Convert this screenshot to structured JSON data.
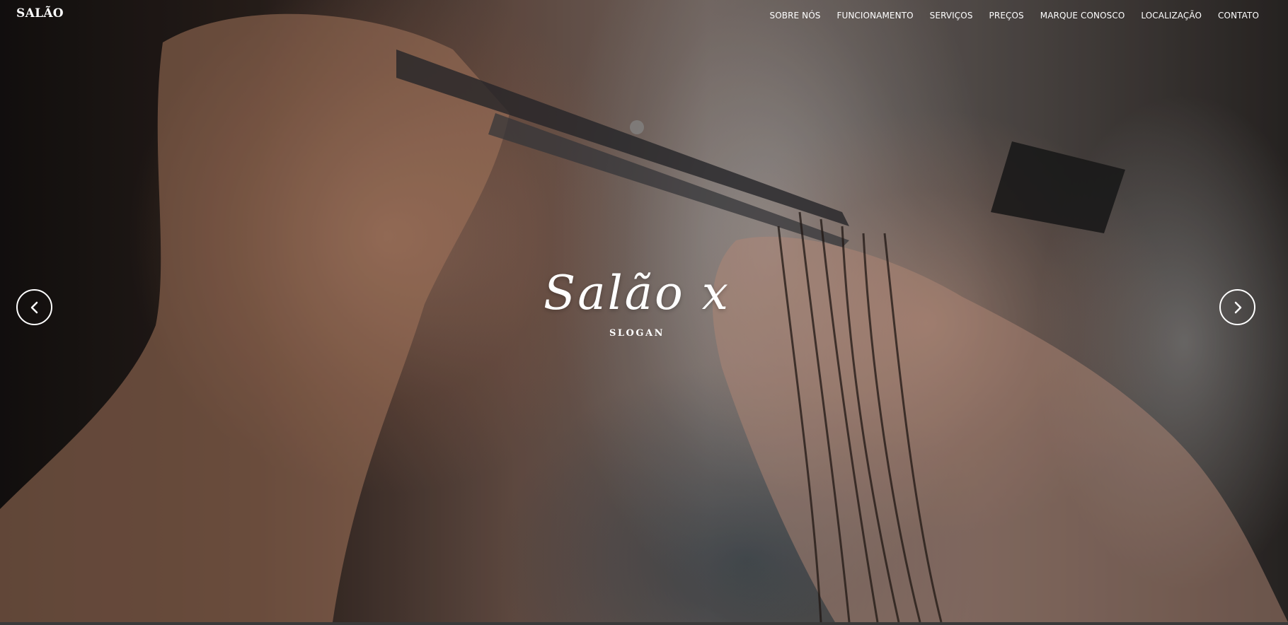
{
  "brand": {
    "name": "SALÃO"
  },
  "nav": {
    "items": [
      {
        "label": "SOBRE NÓS"
      },
      {
        "label": "FUNCIONAMENTO"
      },
      {
        "label": "SERVIÇOS"
      },
      {
        "label": "PREÇOS"
      },
      {
        "label": "MARQUE CONOSCO"
      },
      {
        "label": "LOCALIZAÇÃO"
      },
      {
        "label": "CONTATO"
      }
    ]
  },
  "hero": {
    "title": "Salão x",
    "slogan": "SLOGAN",
    "prev_icon": "chevron-left-icon",
    "next_icon": "chevron-right-icon"
  },
  "colors": {
    "text": "#ffffff",
    "page_background": "#0d0d0d"
  }
}
